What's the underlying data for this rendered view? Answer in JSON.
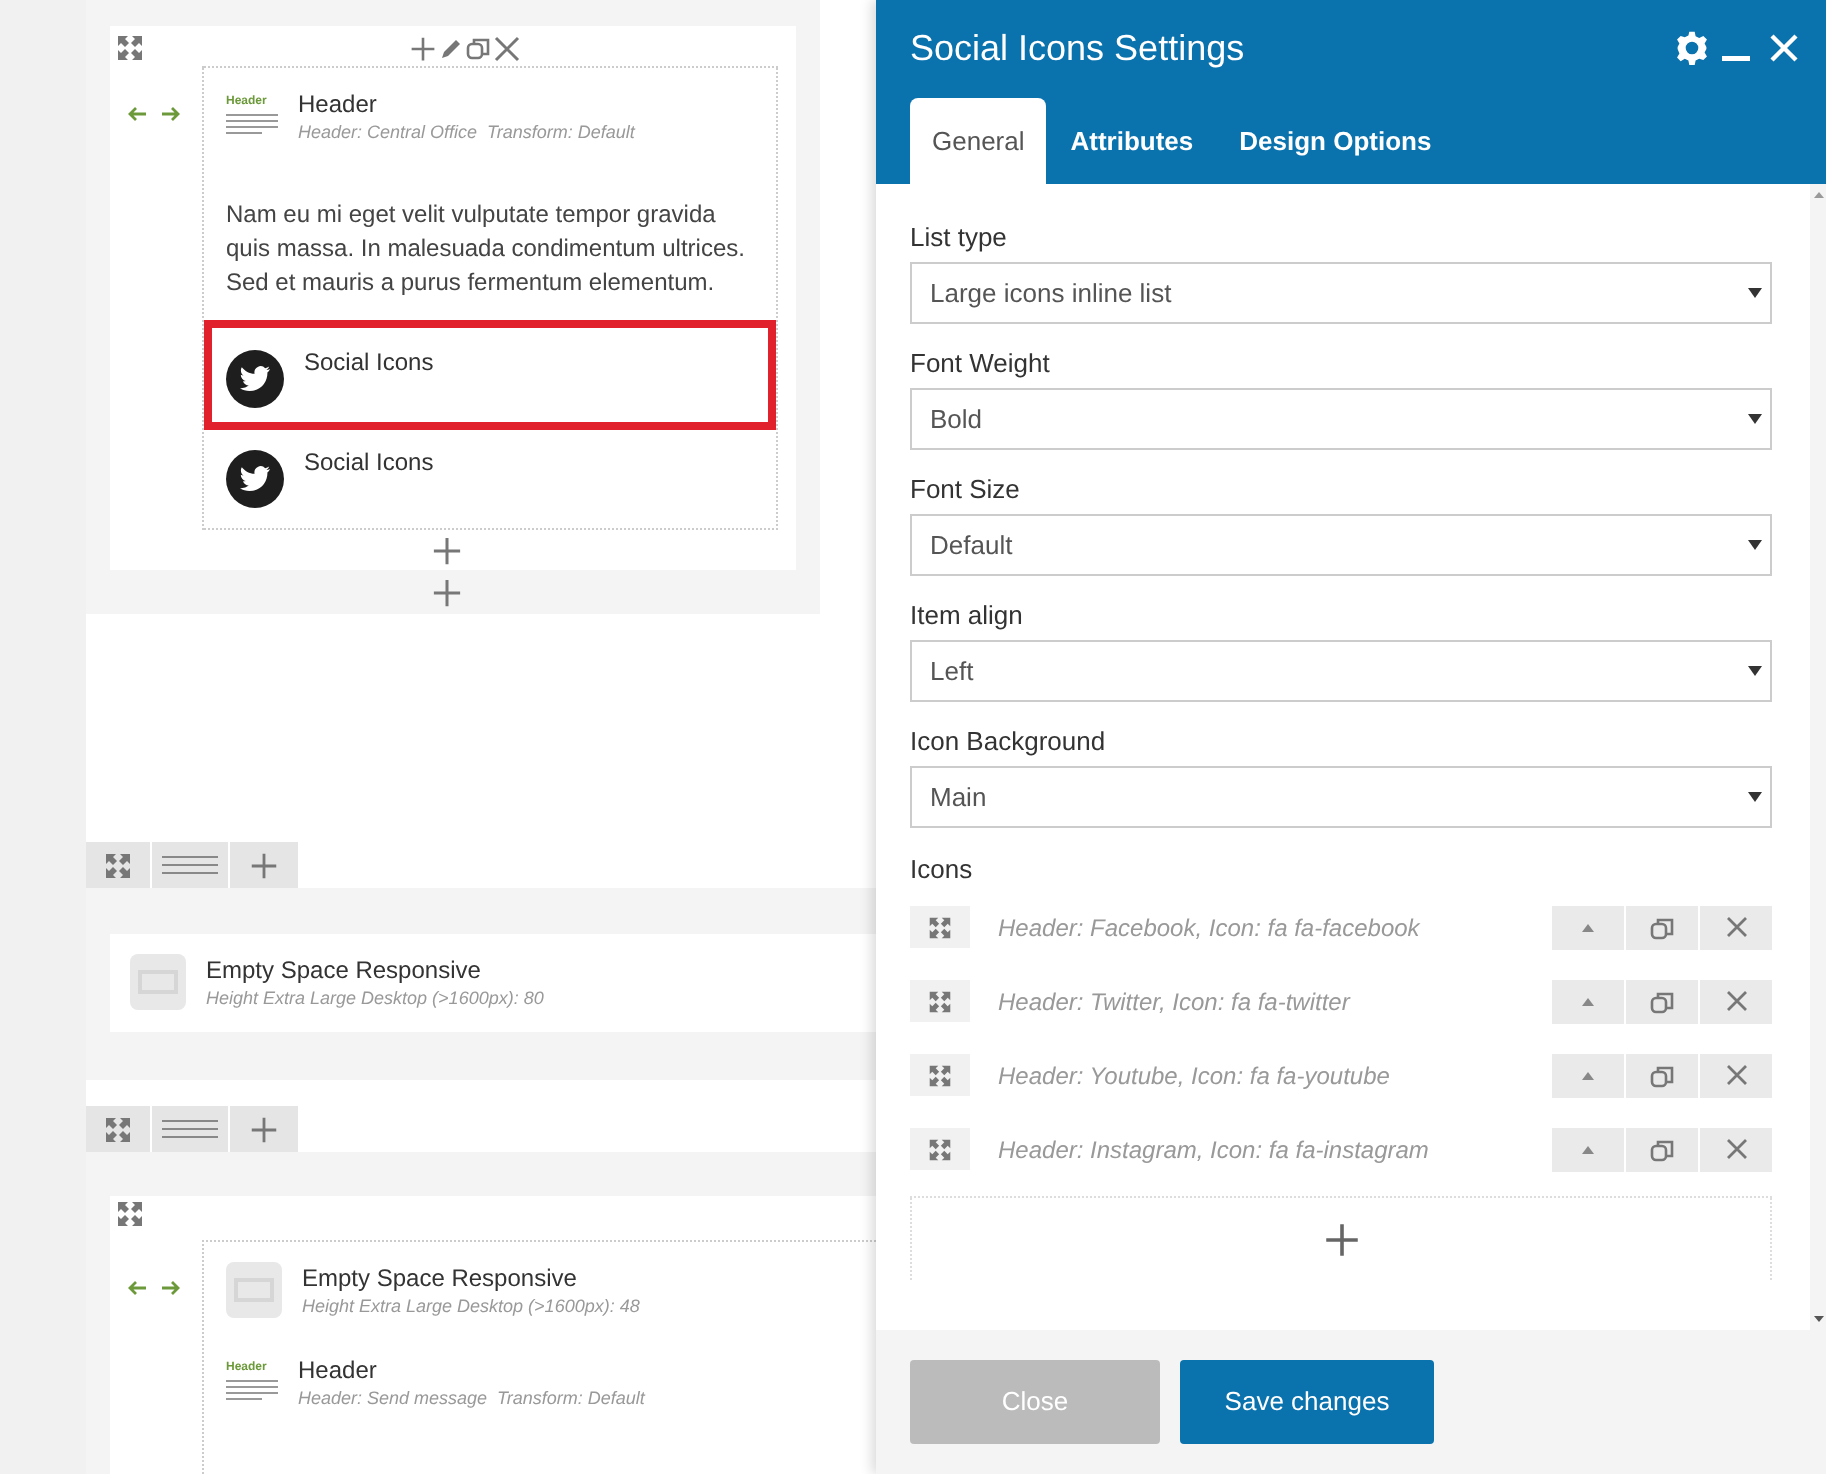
{
  "builder": {
    "first_section": {
      "header": {
        "thumb": "Header",
        "title": "Header",
        "meta": "Header: Central Office  Transform: Default"
      },
      "paragraph": "Nam eu mi eget velit vulputate tempor gravida quis massa. In malesuada condimentum ultrices. Sed et mauris a purus fermentum elementum.",
      "social_elements": [
        {
          "title": "Social Icons",
          "selected": true
        },
        {
          "title": "Social Icons",
          "selected": false
        }
      ]
    },
    "second_section": {
      "title": "Empty Space Responsive",
      "meta": "Height Extra Large Desktop (>1600px): 80"
    },
    "third_section": {
      "elements": [
        {
          "kind": "space",
          "title": "Empty Space Responsive",
          "meta": "Height Extra Large Desktop (>1600px): 48"
        },
        {
          "kind": "header",
          "thumb": "Header",
          "title": "Header",
          "meta": "Header: Send message  Transform: Default"
        }
      ]
    }
  },
  "dialog": {
    "title": "Social Icons Settings",
    "tabs": [
      {
        "label": "General",
        "selected": true
      },
      {
        "label": "Attributes",
        "selected": false
      },
      {
        "label": "Design Options",
        "selected": false
      }
    ],
    "fields": [
      {
        "label": "List type",
        "value": "Large icons inline list"
      },
      {
        "label": "Font Weight",
        "value": "Bold"
      },
      {
        "label": "Font Size",
        "value": "Default"
      },
      {
        "label": "Item align",
        "value": "Left"
      },
      {
        "label": "Icon Background",
        "value": "Main"
      }
    ],
    "icons_label": "Icons",
    "icons": [
      "Header: Facebook, Icon: fa fa-facebook",
      "Header: Twitter, Icon: fa fa-twitter",
      "Header: Youtube, Icon: fa fa-youtube",
      "Header: Instagram, Icon: fa fa-instagram"
    ],
    "buttons": [
      {
        "kind": "secondary",
        "label": "Close"
      },
      {
        "kind": "primary",
        "label": "Save changes"
      }
    ]
  }
}
